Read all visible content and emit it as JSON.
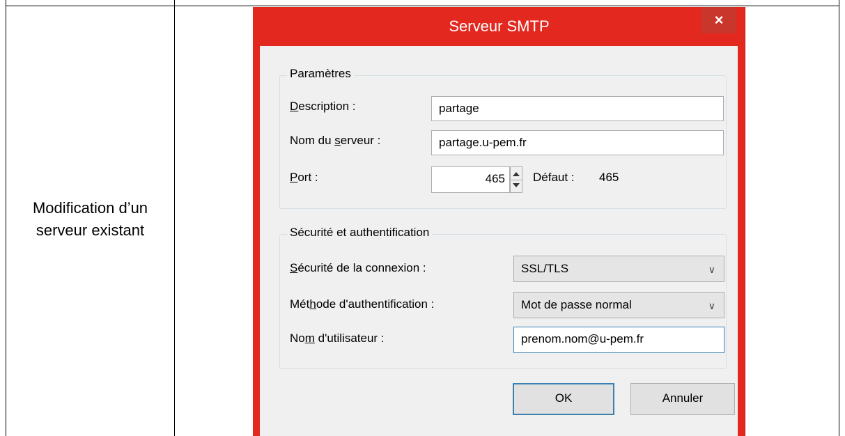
{
  "table": {
    "row_label": "Modification d’un serveur existant"
  },
  "dialog": {
    "title": "Serveur SMTP",
    "close_glyph": "×",
    "settings_group": {
      "legend": "Paramètres",
      "description": {
        "label_underlined": "D",
        "label_rest": "escription :",
        "value": "partage"
      },
      "server_name": {
        "label_before": "Nom du ",
        "label_underlined": "s",
        "label_after": "erveur :",
        "value": "partage.u-pem.fr"
      },
      "port": {
        "label_underlined": "P",
        "label_rest": "ort :",
        "value": "465",
        "default_label": "Défaut :",
        "default_value": "465"
      }
    },
    "security_group": {
      "legend": "Sécurité et authentification",
      "connection_security": {
        "label_underlined": "S",
        "label_rest": "écurité de la connexion :",
        "value": "SSL/TLS"
      },
      "auth_method": {
        "label_before": "Mét",
        "label_underlined": "h",
        "label_after": "ode d'authentification :",
        "value": "Mot de passe normal"
      },
      "username": {
        "label_before": "No",
        "label_underlined": "m",
        "label_after": " d'utilisateur :",
        "value": "prenom.nom@u-pem.fr"
      }
    },
    "buttons": {
      "ok": "OK",
      "cancel": "Annuler"
    }
  }
}
